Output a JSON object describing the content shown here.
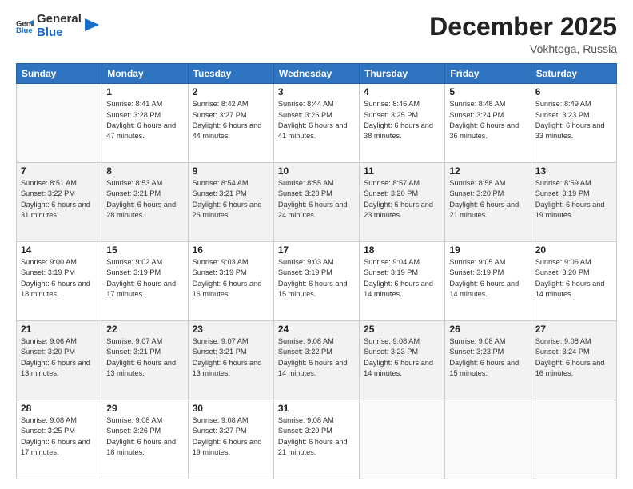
{
  "logo": {
    "general": "General",
    "blue": "Blue"
  },
  "header": {
    "month": "December 2025",
    "location": "Vokhtoga, Russia"
  },
  "days_of_week": [
    "Sunday",
    "Monday",
    "Tuesday",
    "Wednesday",
    "Thursday",
    "Friday",
    "Saturday"
  ],
  "weeks": [
    [
      {
        "day": "",
        "empty": true
      },
      {
        "day": "1",
        "sunrise": "Sunrise: 8:41 AM",
        "sunset": "Sunset: 3:28 PM",
        "daylight": "Daylight: 6 hours and 47 minutes."
      },
      {
        "day": "2",
        "sunrise": "Sunrise: 8:42 AM",
        "sunset": "Sunset: 3:27 PM",
        "daylight": "Daylight: 6 hours and 44 minutes."
      },
      {
        "day": "3",
        "sunrise": "Sunrise: 8:44 AM",
        "sunset": "Sunset: 3:26 PM",
        "daylight": "Daylight: 6 hours and 41 minutes."
      },
      {
        "day": "4",
        "sunrise": "Sunrise: 8:46 AM",
        "sunset": "Sunset: 3:25 PM",
        "daylight": "Daylight: 6 hours and 38 minutes."
      },
      {
        "day": "5",
        "sunrise": "Sunrise: 8:48 AM",
        "sunset": "Sunset: 3:24 PM",
        "daylight": "Daylight: 6 hours and 36 minutes."
      },
      {
        "day": "6",
        "sunrise": "Sunrise: 8:49 AM",
        "sunset": "Sunset: 3:23 PM",
        "daylight": "Daylight: 6 hours and 33 minutes."
      }
    ],
    [
      {
        "day": "7",
        "sunrise": "Sunrise: 8:51 AM",
        "sunset": "Sunset: 3:22 PM",
        "daylight": "Daylight: 6 hours and 31 minutes."
      },
      {
        "day": "8",
        "sunrise": "Sunrise: 8:53 AM",
        "sunset": "Sunset: 3:21 PM",
        "daylight": "Daylight: 6 hours and 28 minutes."
      },
      {
        "day": "9",
        "sunrise": "Sunrise: 8:54 AM",
        "sunset": "Sunset: 3:21 PM",
        "daylight": "Daylight: 6 hours and 26 minutes."
      },
      {
        "day": "10",
        "sunrise": "Sunrise: 8:55 AM",
        "sunset": "Sunset: 3:20 PM",
        "daylight": "Daylight: 6 hours and 24 minutes."
      },
      {
        "day": "11",
        "sunrise": "Sunrise: 8:57 AM",
        "sunset": "Sunset: 3:20 PM",
        "daylight": "Daylight: 6 hours and 23 minutes."
      },
      {
        "day": "12",
        "sunrise": "Sunrise: 8:58 AM",
        "sunset": "Sunset: 3:20 PM",
        "daylight": "Daylight: 6 hours and 21 minutes."
      },
      {
        "day": "13",
        "sunrise": "Sunrise: 8:59 AM",
        "sunset": "Sunset: 3:19 PM",
        "daylight": "Daylight: 6 hours and 19 minutes."
      }
    ],
    [
      {
        "day": "14",
        "sunrise": "Sunrise: 9:00 AM",
        "sunset": "Sunset: 3:19 PM",
        "daylight": "Daylight: 6 hours and 18 minutes."
      },
      {
        "day": "15",
        "sunrise": "Sunrise: 9:02 AM",
        "sunset": "Sunset: 3:19 PM",
        "daylight": "Daylight: 6 hours and 17 minutes."
      },
      {
        "day": "16",
        "sunrise": "Sunrise: 9:03 AM",
        "sunset": "Sunset: 3:19 PM",
        "daylight": "Daylight: 6 hours and 16 minutes."
      },
      {
        "day": "17",
        "sunrise": "Sunrise: 9:03 AM",
        "sunset": "Sunset: 3:19 PM",
        "daylight": "Daylight: 6 hours and 15 minutes."
      },
      {
        "day": "18",
        "sunrise": "Sunrise: 9:04 AM",
        "sunset": "Sunset: 3:19 PM",
        "daylight": "Daylight: 6 hours and 14 minutes."
      },
      {
        "day": "19",
        "sunrise": "Sunrise: 9:05 AM",
        "sunset": "Sunset: 3:19 PM",
        "daylight": "Daylight: 6 hours and 14 minutes."
      },
      {
        "day": "20",
        "sunrise": "Sunrise: 9:06 AM",
        "sunset": "Sunset: 3:20 PM",
        "daylight": "Daylight: 6 hours and 14 minutes."
      }
    ],
    [
      {
        "day": "21",
        "sunrise": "Sunrise: 9:06 AM",
        "sunset": "Sunset: 3:20 PM",
        "daylight": "Daylight: 6 hours and 13 minutes."
      },
      {
        "day": "22",
        "sunrise": "Sunrise: 9:07 AM",
        "sunset": "Sunset: 3:21 PM",
        "daylight": "Daylight: 6 hours and 13 minutes."
      },
      {
        "day": "23",
        "sunrise": "Sunrise: 9:07 AM",
        "sunset": "Sunset: 3:21 PM",
        "daylight": "Daylight: 6 hours and 13 minutes."
      },
      {
        "day": "24",
        "sunrise": "Sunrise: 9:08 AM",
        "sunset": "Sunset: 3:22 PM",
        "daylight": "Daylight: 6 hours and 14 minutes."
      },
      {
        "day": "25",
        "sunrise": "Sunrise: 9:08 AM",
        "sunset": "Sunset: 3:23 PM",
        "daylight": "Daylight: 6 hours and 14 minutes."
      },
      {
        "day": "26",
        "sunrise": "Sunrise: 9:08 AM",
        "sunset": "Sunset: 3:23 PM",
        "daylight": "Daylight: 6 hours and 15 minutes."
      },
      {
        "day": "27",
        "sunrise": "Sunrise: 9:08 AM",
        "sunset": "Sunset: 3:24 PM",
        "daylight": "Daylight: 6 hours and 16 minutes."
      }
    ],
    [
      {
        "day": "28",
        "sunrise": "Sunrise: 9:08 AM",
        "sunset": "Sunset: 3:25 PM",
        "daylight": "Daylight: 6 hours and 17 minutes."
      },
      {
        "day": "29",
        "sunrise": "Sunrise: 9:08 AM",
        "sunset": "Sunset: 3:26 PM",
        "daylight": "Daylight: 6 hours and 18 minutes."
      },
      {
        "day": "30",
        "sunrise": "Sunrise: 9:08 AM",
        "sunset": "Sunset: 3:27 PM",
        "daylight": "Daylight: 6 hours and 19 minutes."
      },
      {
        "day": "31",
        "sunrise": "Sunrise: 9:08 AM",
        "sunset": "Sunset: 3:29 PM",
        "daylight": "Daylight: 6 hours and 21 minutes."
      },
      {
        "day": "",
        "empty": true
      },
      {
        "day": "",
        "empty": true
      },
      {
        "day": "",
        "empty": true
      }
    ]
  ]
}
